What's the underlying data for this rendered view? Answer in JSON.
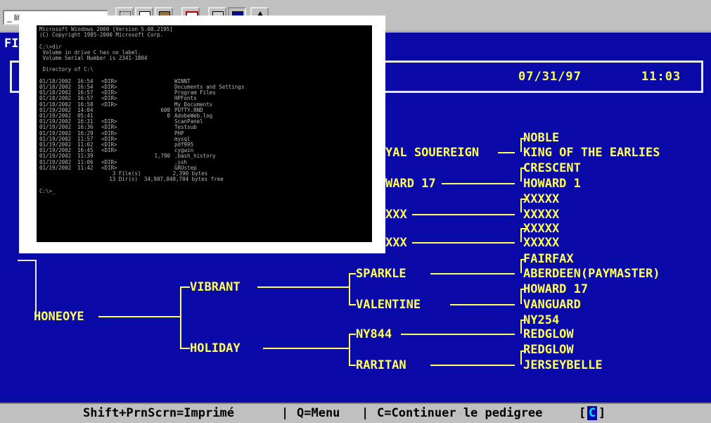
{
  "toolbar": {
    "font_select_value": "_ lit...",
    "buttons": [
      "dotted-select-icon",
      "copy-icon",
      "paste-icon",
      "fullscreen-icon",
      "properties-icon",
      "background-icon",
      "font-icon"
    ]
  },
  "dos": {
    "title_fragment": "FI",
    "date": "07/31/97",
    "time": "11:03",
    "pedigree": {
      "root": "HONEOYE",
      "sire": "VIBRANT",
      "dam": "HOLIDAY",
      "grandparents": {
        "vibrant_sire": "SPARKLE",
        "vibrant_dam": "VALENTINE",
        "holiday_sire": "NY844",
        "holiday_dam": "RARITAN"
      },
      "partial_left": {
        "row1": "YAL SOUEREIGN",
        "row2": "WARD 17",
        "row3": "XXX",
        "row4": "XXX"
      },
      "great_grandparents": [
        "NOBLE",
        "KING OF THE EARLIES",
        "CRESCENT",
        "HOWARD 1",
        "XXXXX",
        "XXXXX",
        "XXXXX",
        "XXXXX",
        "FAIRFAX",
        "ABERDEEN(PAYMASTER)",
        "HOWARD 17",
        "VANGUARD",
        "NY254",
        "REDGLOW",
        "REDGLOW",
        "JERSEYBELLE"
      ]
    }
  },
  "status_bar": {
    "print_hint": "Shift+PrnScrn=Imprimé",
    "menu_hint": "Q=Menu",
    "continue_hint": "C=Continuer le pedigree",
    "key_open": "[",
    "key": "C",
    "key_close": "]",
    "separator": "|"
  },
  "command_prompt": {
    "lines": [
      "Microsoft Windows 2000 [Version 5.00.2195]",
      "(C) Copyright 1985-2000 Microsoft Corp.",
      "",
      "C:\\>dir",
      " Volume in drive C has no label.",
      " Volume Serial Number is 2341-1B04",
      "",
      " Directory of C:\\"
    ],
    "entries": [
      {
        "date": "01/18/2002",
        "time": "16:54",
        "dir": "<DIR>",
        "size": "",
        "name": "WINNT"
      },
      {
        "date": "01/18/2002",
        "time": "16:54",
        "dir": "<DIR>",
        "size": "",
        "name": "Documents and Settings"
      },
      {
        "date": "01/18/2002",
        "time": "16:57",
        "dir": "<DIR>",
        "size": "",
        "name": "Program Files"
      },
      {
        "date": "01/18/2002",
        "time": "16:57",
        "dir": "<DIR>",
        "size": "",
        "name": "HPFonts"
      },
      {
        "date": "01/18/2002",
        "time": "16:58",
        "dir": "<DIR>",
        "size": "",
        "name": "My Documents"
      },
      {
        "date": "01/19/2002",
        "time": "14:04",
        "dir": "",
        "size": "600",
        "name": "PUTTY.RND"
      },
      {
        "date": "01/19/2002",
        "time": "05:41",
        "dir": "",
        "size": "0",
        "name": "AdobeWeb.log"
      },
      {
        "date": "01/19/2002",
        "time": "16:31",
        "dir": "<DIR>",
        "size": "",
        "name": "ScanPanel"
      },
      {
        "date": "01/19/2002",
        "time": "16:36",
        "dir": "<DIR>",
        "size": "",
        "name": "Testsub"
      },
      {
        "date": "01/19/2002",
        "time": "16:29",
        "dir": "<DIR>",
        "size": "",
        "name": "PHP"
      },
      {
        "date": "01/19/2002",
        "time": "11:57",
        "dir": "<DIR>",
        "size": "",
        "name": "mysql"
      },
      {
        "date": "01/19/2002",
        "time": "11:02",
        "dir": "<DIR>",
        "size": "",
        "name": "pdf995"
      },
      {
        "date": "01/19/2002",
        "time": "16:45",
        "dir": "<DIR>",
        "size": "",
        "name": "cygwin"
      },
      {
        "date": "01/19/2002",
        "time": "11:39",
        "dir": "",
        "size": "1,790",
        "name": ".bash_history"
      },
      {
        "date": "01/19/2002",
        "time": "11:06",
        "dir": "<DIR>",
        "size": "",
        "name": ".ssh"
      },
      {
        "date": "01/19/2002",
        "time": "11:42",
        "dir": "<DIR>",
        "size": "",
        "name": "GRUstep"
      }
    ],
    "summary_files": "               3 File(s)          2,390 bytes",
    "summary_dirs": "              13 Dir(s)  34,907,848,704 bytes free",
    "prompt": "C:\\>_"
  }
}
